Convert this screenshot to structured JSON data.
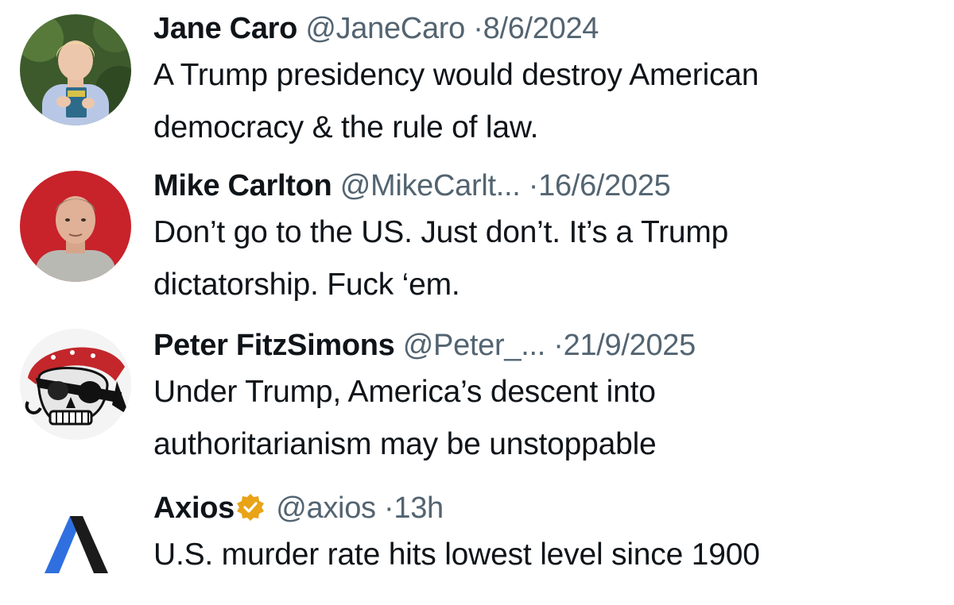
{
  "tweets": [
    {
      "name": "Jane Caro",
      "handle": "@JaneCaro",
      "separator": "·",
      "date": "8/6/2024",
      "line1": "A Trump presidency would destroy American",
      "line2": "democracy & the rule of law.",
      "avatar": "portrait-woman-holding-book"
    },
    {
      "name": "Mike Carlton",
      "handle": "@MikeCarlt...",
      "separator": "·",
      "date": "16/6/2025",
      "line1": "Don’t go to the US. Just don’t. It’s a Trump",
      "line2": "dictatorship.  Fuck ‘em.",
      "avatar": "portrait-man-red-background"
    },
    {
      "name": "Peter FitzSimons",
      "handle": "@Peter_...",
      "separator": "·",
      "date": "21/9/2025",
      "line1": "Under Trump, America’s descent into",
      "line2": "authoritarianism may be unstoppable",
      "avatar": "pirate-skull-bandana"
    },
    {
      "name": "Axios",
      "handle": "@axios",
      "separator": "·",
      "date": "13h",
      "line1": "U.S. murder rate hits lowest level since 1900",
      "avatar": "axios-logo",
      "verified": "gold-verified-badge-icon"
    }
  ],
  "colors": {
    "text": "#0f1419",
    "meta": "#536471",
    "verified_gold": "#e8a317",
    "axios_blue": "#2f6fe0",
    "axios_dark": "#1b1b1b"
  }
}
